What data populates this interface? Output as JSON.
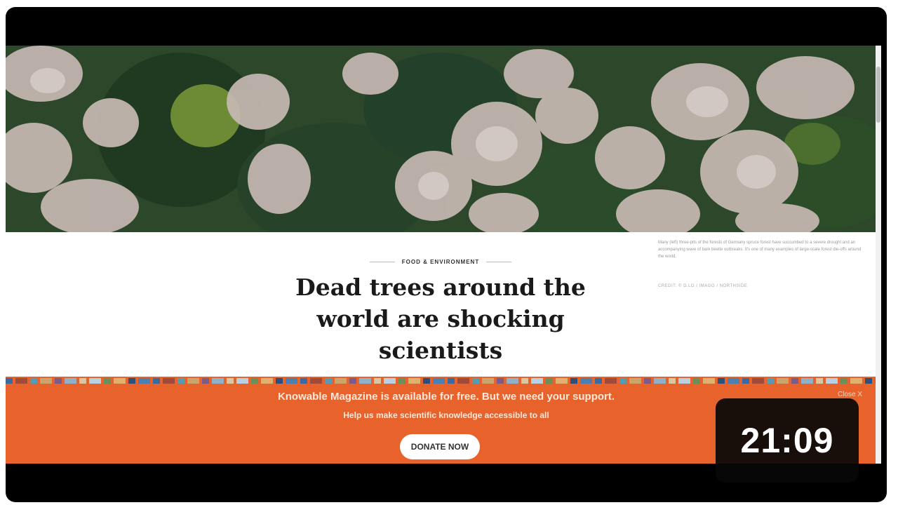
{
  "article": {
    "category": "FOOD & ENVIRONMENT",
    "headline": "Dead trees around the world are shocking scientists"
  },
  "photo": {
    "caption": "Many (left) three-pits of the forests of Germany spruce forest have succumbed to a severe drought and an accompanying wave of bark beetle outbreaks. It's one of many examples of large-scale forest die-offs around the world.",
    "credit": "CREDIT: © D.LO / IMAGO / NORTHSIDE"
  },
  "banner": {
    "title": "Knowable Magazine is available for free. But we need your support.",
    "subtitle": "Help us make scientific knowledge accessible to all",
    "donate_label": "DONATE NOW",
    "close_label": "Close X",
    "background_color": "#e8632b"
  },
  "video": {
    "duration": "21:09"
  }
}
